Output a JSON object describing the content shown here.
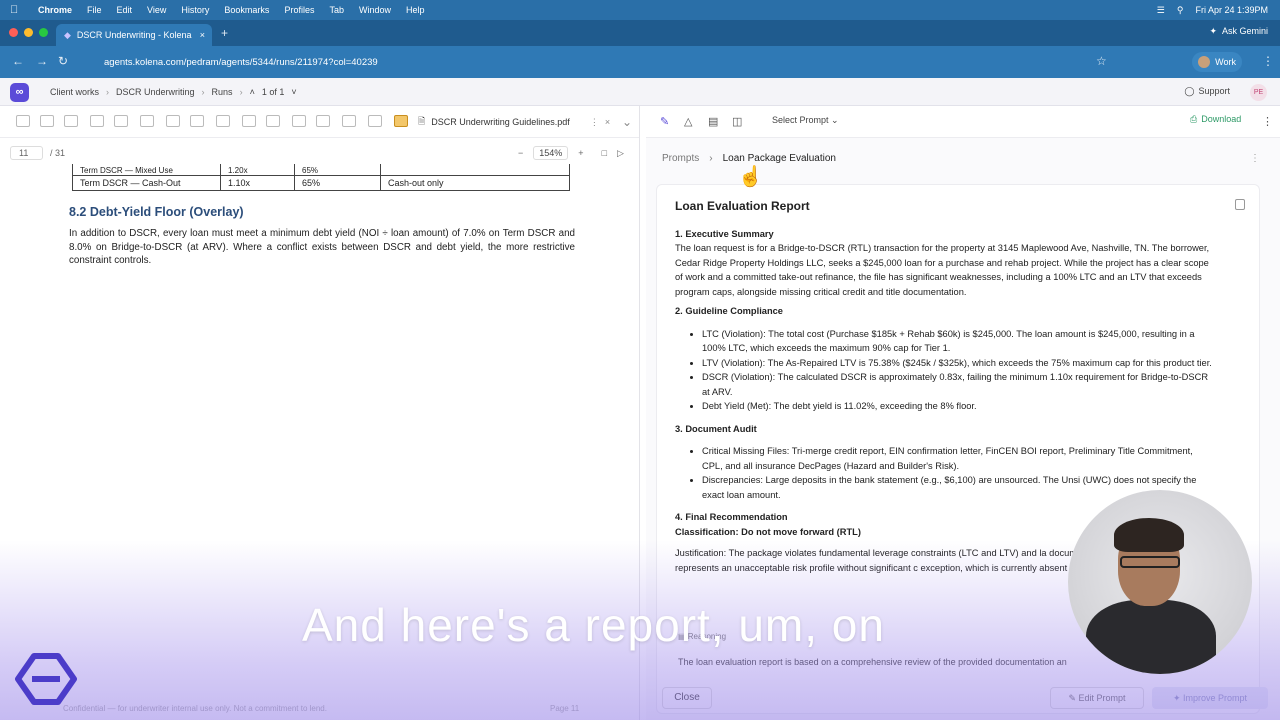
{
  "menubar": {
    "items": [
      "Chrome",
      "File",
      "Edit",
      "View",
      "History",
      "Bookmarks",
      "Profiles",
      "Tab",
      "Window",
      "Help"
    ],
    "datetime": "Fri Apr 24  1:39PM"
  },
  "browser": {
    "tab_title": "DSCR Underwriting - Kolena",
    "url": "agents.kolena.com/pedram/agents/5344/runs/211974?col=40239",
    "ask_gemini": "Ask Gemini",
    "profile": "Work"
  },
  "appbar": {
    "crumbs": [
      "Client works",
      "DSCR Underwriting",
      "Runs"
    ],
    "pager": "1 of 1",
    "support": "Support",
    "user_initials": "PE"
  },
  "pdf": {
    "tab_name": "DSCR Underwriting Guidelines.pdf",
    "page": "11",
    "total_pages": "/ 31",
    "zoom": "154%",
    "table_rows": [
      [
        "Term DSCR — Mixed Use",
        "1.20x",
        "65%",
        ""
      ],
      [
        "Term DSCR — Cash-Out",
        "1.10x",
        "65%",
        "Cash-out only"
      ]
    ],
    "section_heading": "8.2 Debt-Yield Floor (Overlay)",
    "section_text": "In addition to DSCR, every loan must meet a minimum debt yield (NOI ÷ loan amount) of 7.0% on Term DSCR and 8.0% on Bridge-to-DSCR (at ARV). Where a conflict exists between DSCR and debt yield, the more restrictive constraint controls.",
    "footer_conf": "Confidential — for underwriter internal use only. Not a commitment to lend.",
    "footer_page": "Page 11"
  },
  "right": {
    "select_prompt": "Select Prompt",
    "download": "Download",
    "breadcrumb_root": "Prompts",
    "breadcrumb_current": "Loan Package Evaluation",
    "report_title": "Loan Evaluation Report",
    "s1_title": "1. Executive Summary",
    "s1_text": "The loan request is for a Bridge-to-DSCR (RTL) transaction for the property at 3145 Maplewood Ave, Nashville, TN. The borrower, Cedar Ridge Property Holdings LLC, seeks a $245,000 loan for a purchase and rehab project. While the project has a clear scope of work and a committed take-out refinance, the file has significant weaknesses, including a 100% LTC and an LTV that exceeds program caps, alongside missing critical credit and title documentation.",
    "s2_title": "2. Guideline Compliance",
    "s2_items": [
      "LTC (Violation): The total cost (Purchase $185k + Rehab $60k) is $245,000. The loan amount is $245,000, resulting in a 100% LTC, which exceeds the maximum 90% cap for Tier 1.",
      "LTV (Violation): The As-Repaired LTV is 75.38% ($245k / $325k), which exceeds the 75% maximum cap for this product tier.",
      "DSCR (Violation): The calculated DSCR is approximately 0.83x, failing the minimum 1.10x requirement for Bridge-to-DSCR at ARV.",
      "Debt Yield (Met): The debt yield is 11.02%, exceeding the 8% floor."
    ],
    "s3_title": "3. Document Audit",
    "s3_items": [
      "Critical Missing Files: Tri-merge credit report, EIN confirmation letter, FinCEN BOI report, Preliminary Title Commitment, CPL, and all insurance DecPages (Hazard and Builder's Risk).",
      "Discrepancies: Large deposits in the bank statement (e.g., $6,100) are unsourced. The Unsi (UWC) does not specify the exact loan amount."
    ],
    "s4_title": "4. Final Recommendation",
    "s4_class": "Classification: Do not move forward (RTL)",
    "s4_just": "Justification: The package violates fundamental leverage constraints (LTC and LTV) and la documentation. The 100% LTC represents an unacceptable risk profile without significant c exception, which is currently absent from the file.",
    "reasoning_label": "Reasoning",
    "reasoning_text": "The loan evaluation report is based on a comprehensive review of the provided documentation an",
    "close": "Close",
    "edit_prompt": "Edit Prompt",
    "improve_prompt": "Improve Prompt"
  },
  "caption": "And here's a report, um, on"
}
